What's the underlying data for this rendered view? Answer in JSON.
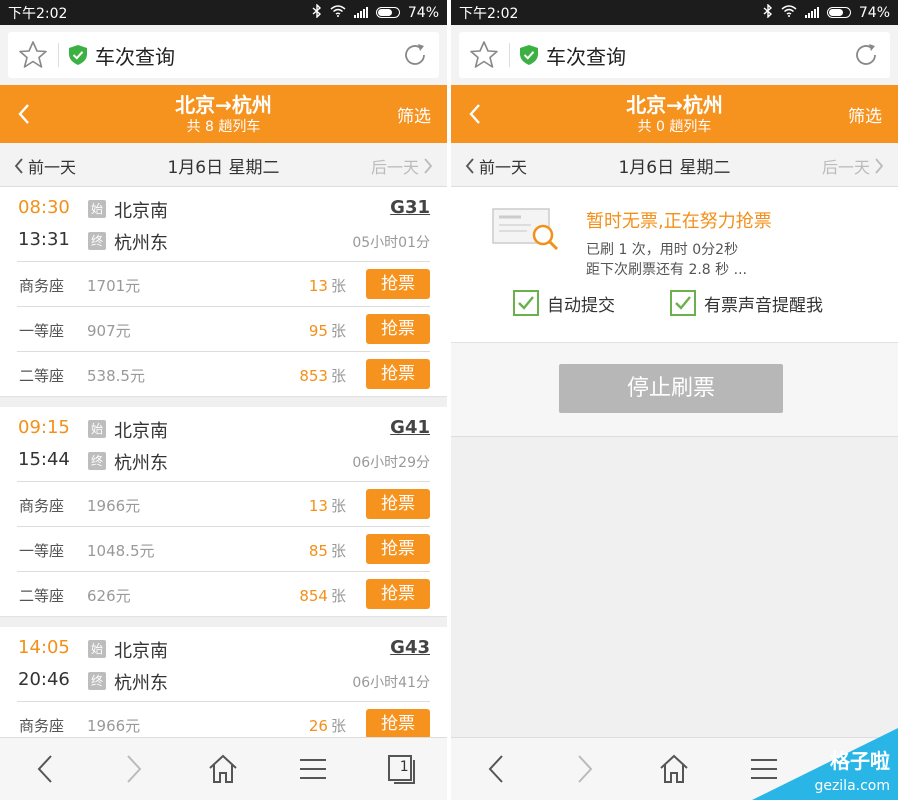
{
  "status_bar": {
    "time": "下午2:02",
    "battery": "74%",
    "battery_level": 0.74
  },
  "browser": {
    "title": "车次查询"
  },
  "left": {
    "header": {
      "title": "北京→杭州",
      "subtitle": "共 8 趟列车",
      "filter": "筛选"
    },
    "datebar": {
      "prev": "前一天",
      "date": "1月6日 星期二",
      "next": "后一天"
    },
    "trains": [
      {
        "dep_time": "08:30",
        "arr_time": "13:31",
        "dep_badge": "始",
        "arr_badge": "终",
        "dep_station": "北京南",
        "arr_station": "杭州东",
        "code": "G31",
        "duration": "05小时01分",
        "seats": [
          {
            "name": "商务座",
            "price": "1701元",
            "count": "13",
            "unit": "张",
            "button": "抢票"
          },
          {
            "name": "一等座",
            "price": "907元",
            "count": "95",
            "unit": "张",
            "button": "抢票"
          },
          {
            "name": "二等座",
            "price": "538.5元",
            "count": "853",
            "unit": "张",
            "button": "抢票"
          }
        ]
      },
      {
        "dep_time": "09:15",
        "arr_time": "15:44",
        "dep_badge": "始",
        "arr_badge": "终",
        "dep_station": "北京南",
        "arr_station": "杭州东",
        "code": "G41",
        "duration": "06小时29分",
        "seats": [
          {
            "name": "商务座",
            "price": "1966元",
            "count": "13",
            "unit": "张",
            "button": "抢票"
          },
          {
            "name": "一等座",
            "price": "1048.5元",
            "count": "85",
            "unit": "张",
            "button": "抢票"
          },
          {
            "name": "二等座",
            "price": "626元",
            "count": "854",
            "unit": "张",
            "button": "抢票"
          }
        ]
      },
      {
        "dep_time": "14:05",
        "arr_time": "20:46",
        "dep_badge": "始",
        "arr_badge": "终",
        "dep_station": "北京南",
        "arr_station": "杭州东",
        "code": "G43",
        "duration": "06小时41分",
        "seats": [
          {
            "name": "商务座",
            "price": "1966元",
            "count": "26",
            "unit": "张",
            "button": "抢票"
          }
        ]
      }
    ],
    "tab_count": "1"
  },
  "right": {
    "header": {
      "title": "北京→杭州",
      "subtitle": "共 0 趟列车",
      "filter": "筛选"
    },
    "datebar": {
      "prev": "前一天",
      "date": "1月6日 星期二",
      "next": "后一天"
    },
    "grab": {
      "title": "暂时无票,正在努力抢票",
      "line1": "已刷 1 次，用时 0分2秒",
      "line2": "距下次刷票还有 2.8 秒 ...",
      "auto_submit": "自动提交",
      "sound_alert": "有票声音提醒我",
      "stop_button": "停止刷票"
    }
  },
  "watermark": {
    "cn": "格子啦",
    "en": "gezila.com"
  },
  "colors": {
    "accent": "#f6921e",
    "check": "#6ab04c",
    "shield": "#3cb043",
    "watermark": "#29b6e6"
  }
}
